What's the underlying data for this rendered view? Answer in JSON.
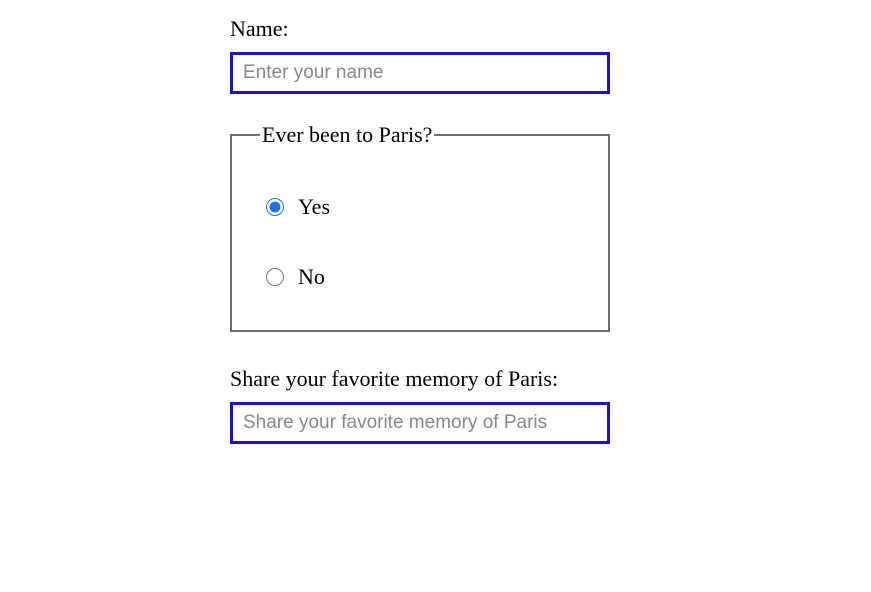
{
  "form": {
    "name": {
      "label": "Name:",
      "placeholder": "Enter your name",
      "value": ""
    },
    "visited": {
      "legend": "Ever been to Paris?",
      "options": {
        "yes": "Yes",
        "no": "No"
      },
      "selected": "yes"
    },
    "memory": {
      "label": "Share your favorite memory of Paris:",
      "placeholder": "Share your favorite memory of Paris",
      "value": ""
    }
  }
}
